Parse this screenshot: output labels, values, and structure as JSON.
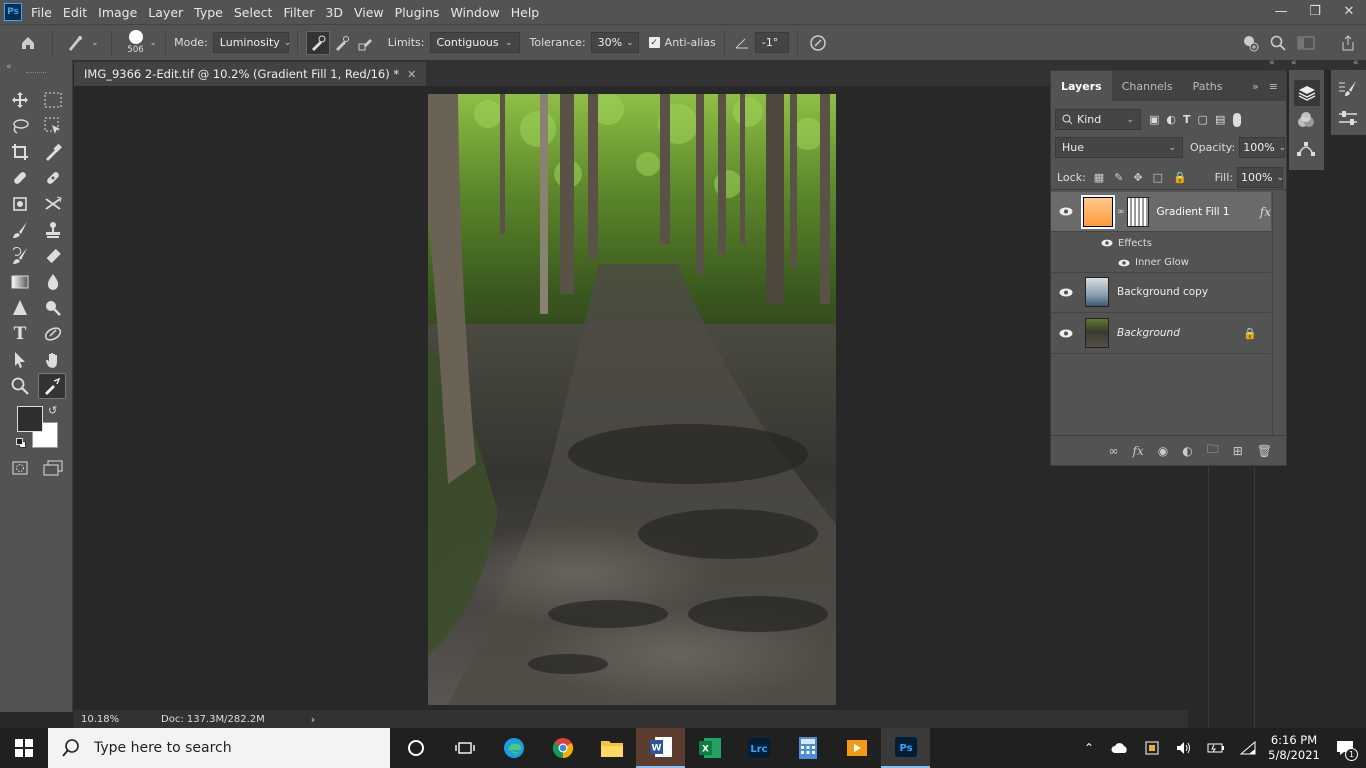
{
  "menu": {
    "logo": "Ps",
    "items": [
      "File",
      "Edit",
      "Image",
      "Layer",
      "Type",
      "Select",
      "Filter",
      "3D",
      "View",
      "Plugins",
      "Window",
      "Help"
    ]
  },
  "options": {
    "brush_size": "506",
    "mode_label": "Mode:",
    "mode_value": "Luminosity",
    "limits_label": "Limits:",
    "limits_value": "Contiguous",
    "tolerance_label": "Tolerance:",
    "tolerance_value": "30%",
    "antialias_label": "Anti-alias",
    "angle_value": "-1°"
  },
  "document": {
    "tab_title": "IMG_9366 2-Edit.tif @ 10.2% (Gradient Fill 1, Red/16) *",
    "zoom": "10.18%",
    "doc_info": "Doc: 137.3M/282.2M"
  },
  "layers_panel": {
    "tabs": [
      "Layers",
      "Channels",
      "Paths"
    ],
    "filter_kind": "Kind",
    "blend_mode": "Hue",
    "opacity_label": "Opacity:",
    "opacity_value": "100%",
    "lock_label": "Lock:",
    "fill_label": "Fill:",
    "fill_value": "100%",
    "layers": [
      {
        "name": "Gradient Fill 1",
        "fx": "fx",
        "effects_label": "Effects",
        "effect": "Inner Glow"
      },
      {
        "name": "Background copy"
      },
      {
        "name": "Background"
      }
    ]
  },
  "taskbar": {
    "search_placeholder": "Type here to search",
    "time": "6:16 PM",
    "date": "5/8/2021",
    "notif_count": "1"
  },
  "colors": {
    "ui_dark": "#282828",
    "panel": "#535353",
    "accent": "#31a8ff"
  }
}
